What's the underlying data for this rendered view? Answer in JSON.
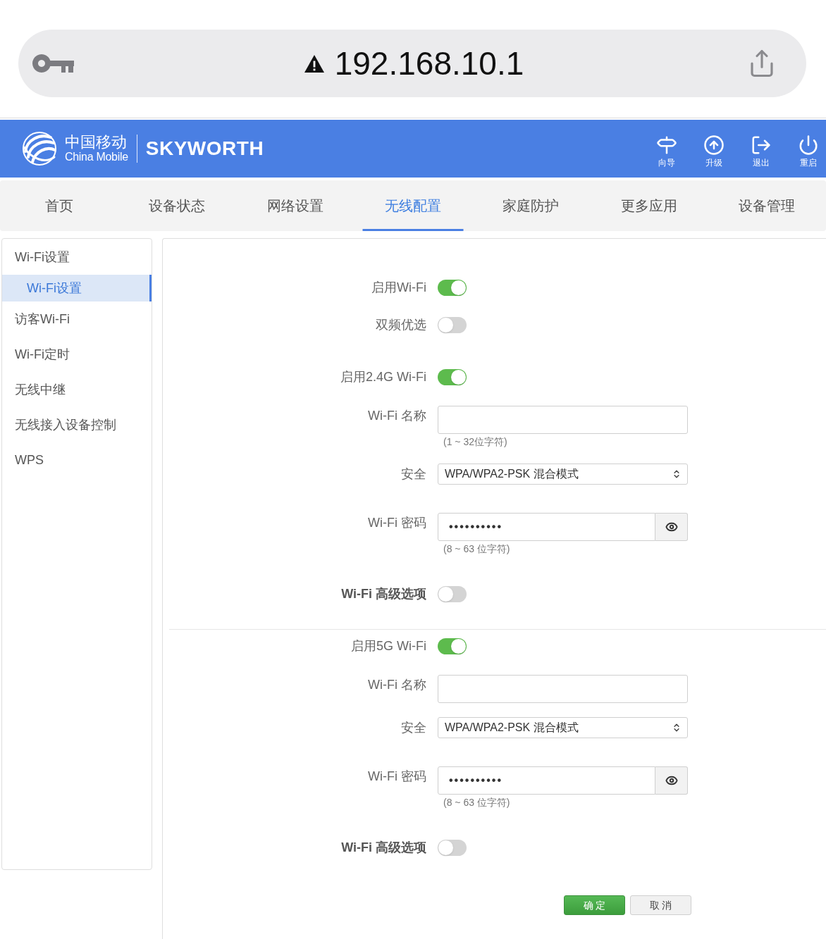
{
  "browser": {
    "url": "192.168.10.1"
  },
  "header": {
    "brand": "中国移动",
    "brand_sub": "China Mobile",
    "partner": "SKYWORTH",
    "actions": [
      {
        "kind": "wizard",
        "label": "向导"
      },
      {
        "kind": "upgrade",
        "label": "升级"
      },
      {
        "kind": "logout",
        "label": "退出"
      },
      {
        "kind": "restart",
        "label": "重启"
      }
    ]
  },
  "nav": {
    "tabs": [
      {
        "label": "首页",
        "selected": false
      },
      {
        "label": "设备状态",
        "selected": false
      },
      {
        "label": "网络设置",
        "selected": false
      },
      {
        "label": "无线配置",
        "selected": true
      },
      {
        "label": "家庭防护",
        "selected": false
      },
      {
        "label": "更多应用",
        "selected": false
      },
      {
        "label": "设备管理",
        "selected": false
      }
    ]
  },
  "sidebar": {
    "items": [
      {
        "label": "Wi-Fi设置",
        "selected": false,
        "children": [
          {
            "label": "Wi-Fi设置",
            "selected": true
          }
        ]
      },
      {
        "label": "访客Wi-Fi",
        "selected": false
      },
      {
        "label": "Wi-Fi定时",
        "selected": false
      },
      {
        "label": "无线中继",
        "selected": false
      },
      {
        "label": "无线接入设备控制",
        "selected": false
      },
      {
        "label": "WPS",
        "selected": false
      }
    ]
  },
  "wifi": {
    "rows": [
      {
        "kind": "toggle",
        "label": "启用Wi-Fi",
        "on": true
      },
      {
        "kind": "toggle",
        "label": "双频优选",
        "on": false
      }
    ]
  },
  "bands": [
    {
      "rows": [
        {
          "kind": "toggle",
          "label": "启用2.4G Wi-Fi",
          "on": true
        },
        {
          "kind": "text",
          "label": "Wi-Fi 名称",
          "hint": "(1 ~ 32位字符)"
        },
        {
          "kind": "select",
          "label": "安全",
          "value": "WPA/WPA2-PSK 混合模式"
        },
        {
          "kind": "password",
          "label": "Wi-Fi 密码",
          "value": "••••••••••",
          "hint": "(8 ~ 63 位字符)"
        },
        {
          "kind": "toggle_strong",
          "label": "Wi-Fi 高级选项",
          "on": false
        }
      ]
    },
    {
      "rows": [
        {
          "kind": "toggle",
          "label": "启用5G Wi-Fi",
          "on": true
        },
        {
          "kind": "text",
          "label": "Wi-Fi 名称"
        },
        {
          "kind": "select",
          "label": "安全",
          "value": "WPA/WPA2-PSK 混合模式"
        },
        {
          "kind": "password",
          "label": "Wi-Fi 密码",
          "value": "••••••••••",
          "hint": "(8 ~ 63 位字符)"
        },
        {
          "kind": "toggle_strong",
          "label": "Wi-Fi 高级选项",
          "on": false
        }
      ]
    }
  ],
  "buttons": [
    {
      "kind": "primary",
      "label": "确 定"
    },
    {
      "kind": "secondary",
      "label": "取 消"
    }
  ]
}
